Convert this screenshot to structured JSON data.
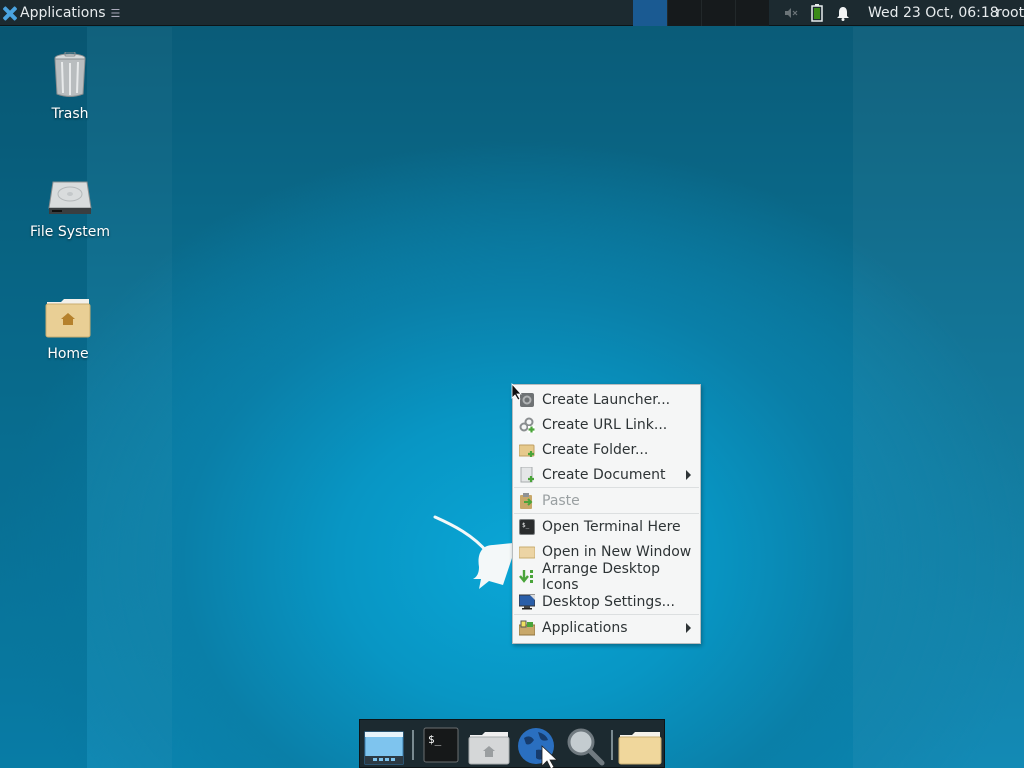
{
  "panel": {
    "app_menu_label": "Applications",
    "app_menu_icon": "xfce-logo-icon",
    "workspaces": [
      {
        "name": "workspace-1",
        "active": true
      },
      {
        "name": "workspace-2",
        "active": false
      },
      {
        "name": "workspace-3",
        "active": false
      },
      {
        "name": "workspace-4",
        "active": false
      }
    ],
    "tray": [
      "volume-muted-icon",
      "battery-icon",
      "notification-bell-icon"
    ],
    "clock": "Wed 23 Oct, 06:18",
    "user": "root"
  },
  "desktop": {
    "icons": [
      {
        "label": "Trash",
        "icon": "trash-icon"
      },
      {
        "label": "File System",
        "icon": "hard-drive-icon"
      },
      {
        "label": "Home",
        "icon": "home-folder-icon"
      }
    ]
  },
  "context_menu": {
    "items": [
      {
        "label": "Create Launcher...",
        "icon": "launcher-gear-icon",
        "disabled": false,
        "submenu": false
      },
      {
        "label": "Create URL Link...",
        "icon": "url-link-icon",
        "disabled": false,
        "submenu": false
      },
      {
        "label": "Create Folder...",
        "icon": "new-folder-icon",
        "disabled": false,
        "submenu": false
      },
      {
        "label": "Create Document",
        "icon": "new-document-icon",
        "disabled": false,
        "submenu": true
      },
      {
        "label": "Paste",
        "icon": "paste-icon",
        "disabled": true,
        "submenu": false
      },
      {
        "label": "Open Terminal Here",
        "icon": "terminal-icon",
        "disabled": false,
        "submenu": false
      },
      {
        "label": "Open in New Window",
        "icon": "folder-icon",
        "disabled": false,
        "submenu": false
      },
      {
        "label": "Arrange Desktop Icons",
        "icon": "arrange-icon",
        "disabled": false,
        "submenu": false
      },
      {
        "label": "Desktop Settings...",
        "icon": "monitor-icon",
        "disabled": false,
        "submenu": false
      },
      {
        "label": "Applications",
        "icon": "applications-icon",
        "disabled": false,
        "submenu": true
      }
    ]
  },
  "dock": {
    "items": [
      {
        "name": "show-desktop",
        "icon": "show-desktop-icon"
      },
      {
        "name": "terminal",
        "icon": "terminal-icon"
      },
      {
        "name": "file-manager",
        "icon": "home-folder-icon"
      },
      {
        "name": "web-browser",
        "icon": "globe-icon"
      },
      {
        "name": "app-finder",
        "icon": "magnifier-icon"
      },
      {
        "name": "folder",
        "icon": "folder-icon"
      }
    ]
  },
  "colors": {
    "panel_bg": "#1c2a30",
    "workspace_active": "#1a5a92",
    "menu_bg": "#f5f6f6",
    "desktop_accent": "#0896c4"
  }
}
